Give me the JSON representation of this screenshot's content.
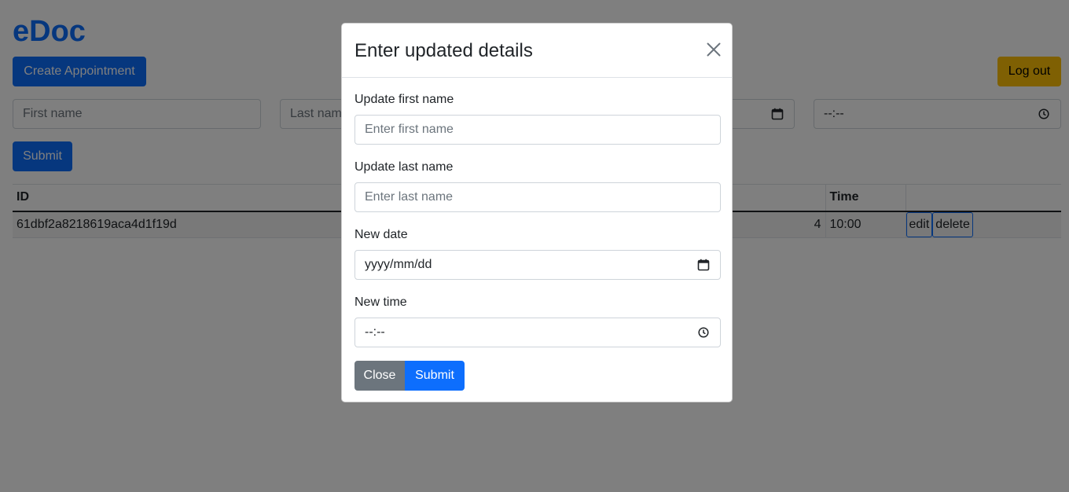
{
  "app": {
    "brand": "eDoc",
    "create_label": "Create Appointment",
    "logout_label": "Log out"
  },
  "booking_form": {
    "first_name_placeholder": "First name",
    "last_name_placeholder": "Last name",
    "time_value": "--:--",
    "submit_label": "Submit"
  },
  "table": {
    "headers": {
      "id": "ID",
      "time": "Time"
    },
    "rows": [
      {
        "id": "61dbf2a8218619aca4d1f19d",
        "date_fragment": "4",
        "time": "10:00",
        "edit_label": "edit",
        "delete_label": "delete"
      }
    ]
  },
  "modal": {
    "title": "Enter updated details",
    "first_name_label": "Update first name",
    "first_name_placeholder": "Enter first name",
    "last_name_label": "Update last name",
    "last_name_placeholder": "Enter last name",
    "date_label": "New date",
    "date_value": "yyyy/mm/dd",
    "time_label": "New time",
    "time_value": "--:--",
    "close_label": "Close",
    "submit_label": "Submit"
  },
  "colors": {
    "primary": "#0d6efd",
    "warning": "#ffc107",
    "secondary": "#6c757d",
    "backdrop": "rgba(0,0,0,0.5)"
  }
}
